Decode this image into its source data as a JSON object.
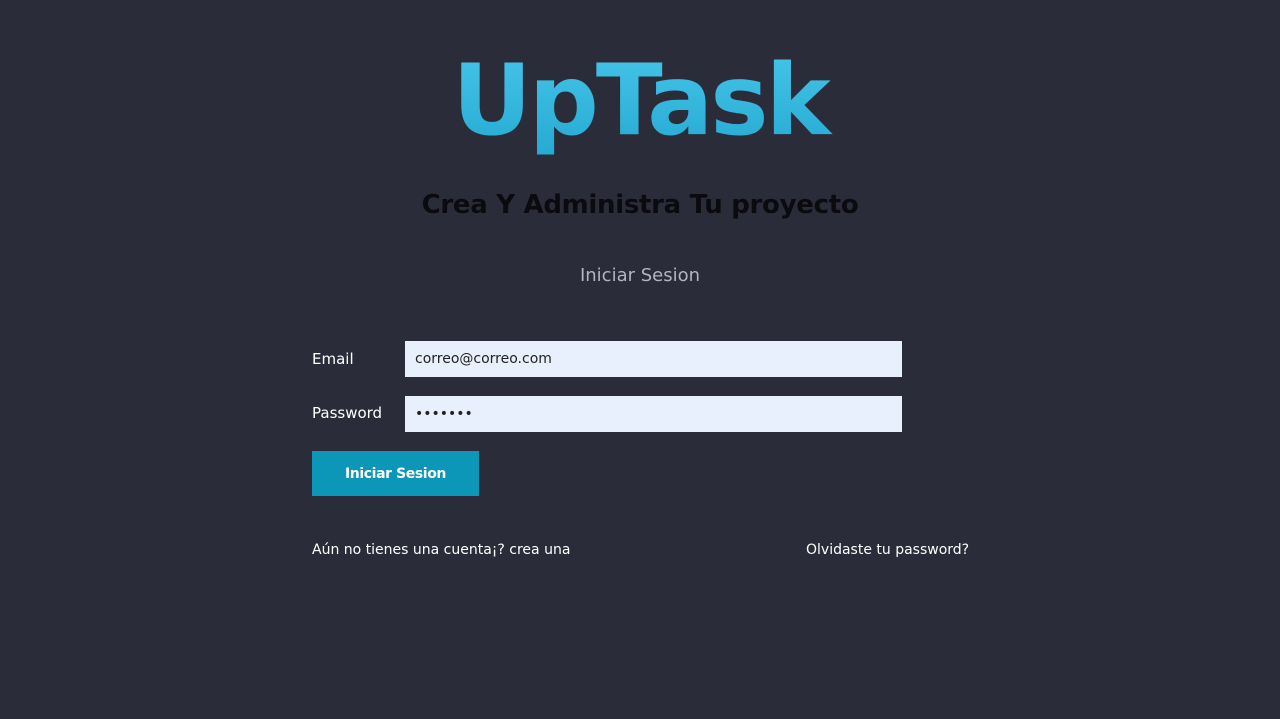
{
  "app": {
    "logo_text": "UpTask",
    "tagline": "Crea Y Administra Tu proyecto"
  },
  "login": {
    "heading": "Iniciar Sesion",
    "email_label": "Email",
    "email_value": "correo@correo.com",
    "password_label": "Password",
    "password_value": "1234567",
    "submit_label": "Iniciar Sesion"
  },
  "links": {
    "create_account": "Aún no tienes una cuenta¡? crea una",
    "forgot_password": "Olvidaste tu password?"
  },
  "colors": {
    "background": "#2b2c3a",
    "accent": "#0c96b8",
    "logo_gradient_top": "#46c4e8",
    "input_background": "#e8f0fe"
  }
}
